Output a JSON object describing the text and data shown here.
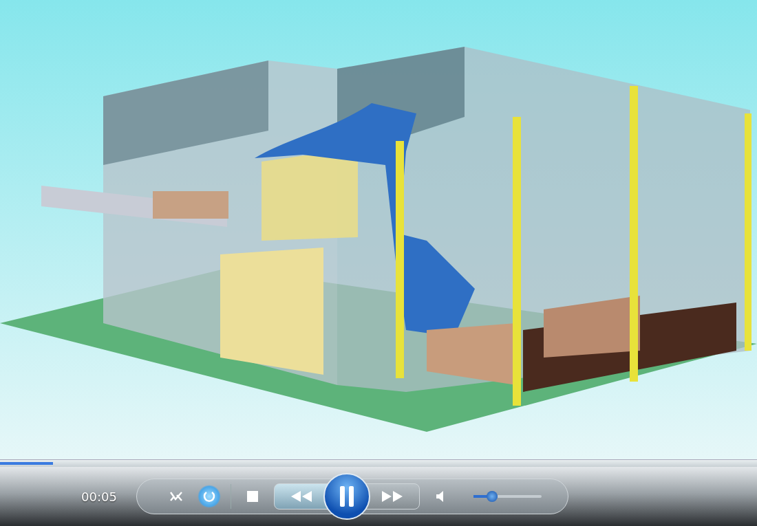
{
  "player": {
    "time": "00:05",
    "progress": {
      "level": 0.07
    },
    "shuffle": {
      "on": false
    },
    "repeat": {
      "on": true
    },
    "playing": true,
    "volume": {
      "level": 0.3
    }
  }
}
